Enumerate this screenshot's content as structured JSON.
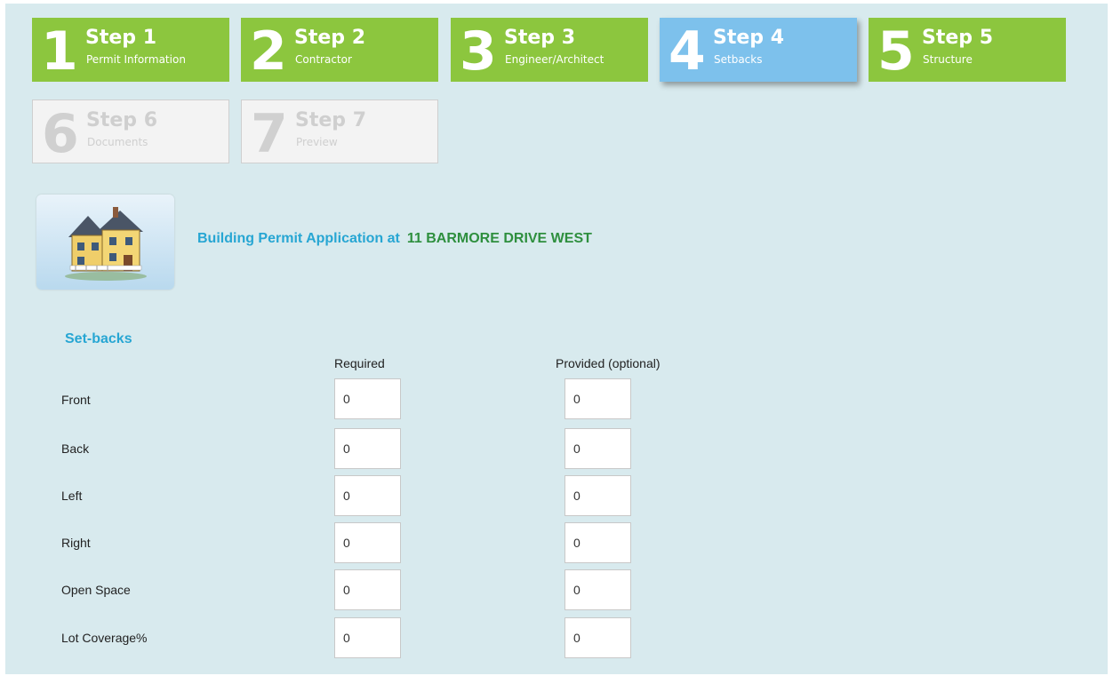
{
  "wizard": {
    "steps": [
      {
        "number": "1",
        "title": "Step 1",
        "subtitle": "Permit Information",
        "state": "done"
      },
      {
        "number": "2",
        "title": "Step 2",
        "subtitle": "Contractor",
        "state": "done"
      },
      {
        "number": "3",
        "title": "Step 3",
        "subtitle": "Engineer/Architect",
        "state": "done"
      },
      {
        "number": "4",
        "title": "Step 4",
        "subtitle": "Setbacks",
        "state": "active"
      },
      {
        "number": "5",
        "title": "Step 5",
        "subtitle": "Structure",
        "state": "done"
      },
      {
        "number": "6",
        "title": "Step 6",
        "subtitle": "Documents",
        "state": "disabled"
      },
      {
        "number": "7",
        "title": "Step 7",
        "subtitle": "Preview",
        "state": "disabled"
      }
    ]
  },
  "header": {
    "label": "Building Permit Application at",
    "address": "11  BARMORE DRIVE WEST",
    "icon": "house-icon"
  },
  "setbacks": {
    "title": "Set-backs",
    "col_required": "Required",
    "col_provided": "Provided (optional)",
    "rows": [
      {
        "label": "Front",
        "required": "0",
        "provided": "0"
      },
      {
        "label": "Back",
        "required": "0",
        "provided": "0"
      },
      {
        "label": "Left",
        "required": "0",
        "provided": "0"
      },
      {
        "label": "Right",
        "required": "0",
        "provided": "0"
      },
      {
        "label": "Open Space",
        "required": "0",
        "provided": "0"
      },
      {
        "label": "Lot Coverage%",
        "required": "0",
        "provided": "0"
      }
    ]
  },
  "colors": {
    "step_done": "#8cc63e",
    "step_active": "#7dc1ec",
    "step_disabled": "#f3f3f3",
    "heading_blue": "#27a6d3",
    "address_green": "#2e8f3e",
    "panel_bg": "#d8eaee"
  }
}
